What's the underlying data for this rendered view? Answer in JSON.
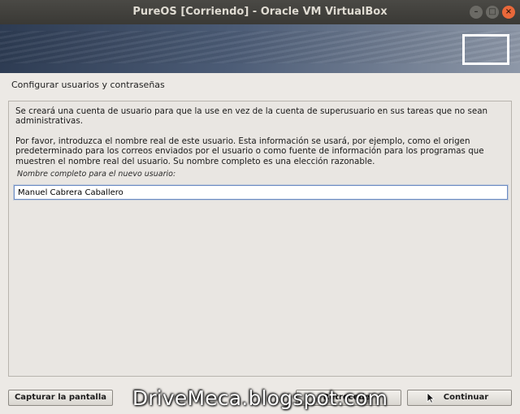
{
  "window": {
    "title": "PureOS [Corriendo] - Oracle VM VirtualBox",
    "controls": {
      "minimize": "–",
      "maximize": "□",
      "close": "×"
    }
  },
  "installer": {
    "section_title": "Configurar usuarios y contraseñas",
    "paragraph1": "Se creará una cuenta de usuario para que la use en vez de la cuenta de superusuario en sus tareas que no sean administrativas.",
    "paragraph2": "Por favor, introduzca el nombre real de este usuario. Esta información se usará, por ejemplo, como el origen predeterminado para los correos enviados por el usuario o como fuente de información para los programas que muestren el nombre real del usuario. Su nombre completo es una elección razonable.",
    "field_label": "Nombre completo para el nuevo usuario:",
    "field_value": "Manuel Cabrera Caballero"
  },
  "buttons": {
    "capture": "Capturar la pantalla",
    "back": "Retroceder",
    "continue": "Continuar"
  },
  "watermark": "DriveMeca.blogspot.com"
}
